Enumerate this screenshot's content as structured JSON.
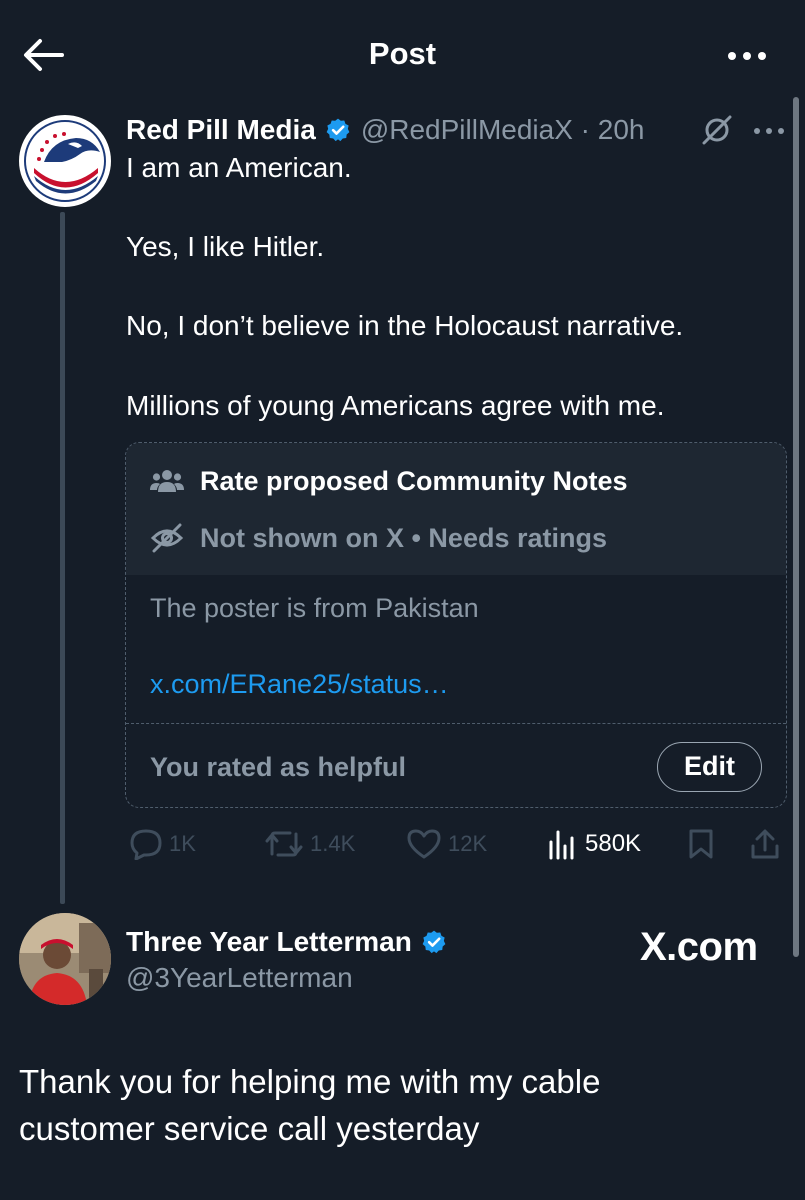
{
  "header": {
    "title": "Post",
    "back_icon": "arrow-left-icon",
    "more_icon": "more-horizontal-icon"
  },
  "post": {
    "author_name": "Red Pill Media",
    "handle": "@RedPillMediaX",
    "time": "20h",
    "handle_time": "@RedPillMediaX · 20h",
    "verified_icon": "verified-badge-icon",
    "lines": [
      "I am an American.",
      "Yes, I like Hitler.",
      "No, I don’t believe in the Holocaust narrative.",
      "Millions of young Americans agree with me."
    ],
    "community_note": {
      "title": "Rate proposed Community Notes",
      "status": "Not shown on X • Needs ratings",
      "note_text": "The poster is from Pakistan",
      "link_text": "x.com/ERane25/status…",
      "rated_text": "You rated as helpful",
      "edit_label": "Edit"
    },
    "actions": {
      "replies": "1K",
      "reposts": "1.4K",
      "likes": "12K",
      "views": "580K"
    }
  },
  "reply": {
    "author_name": "Three Year Letterman",
    "handle": "@3YearLetterman",
    "watermark": "X.com",
    "text": "Thank you for helping me with my cable customer service call yesterday"
  },
  "colors": {
    "background": "#151d28",
    "accent": "#1d9bf0",
    "muted": "#8b98a5"
  }
}
